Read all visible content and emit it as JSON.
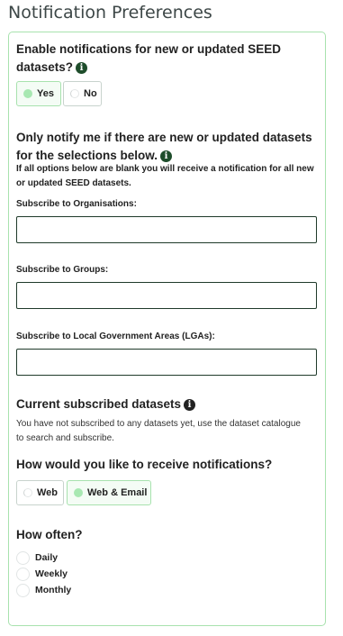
{
  "page_title": "Notification Preferences",
  "enable": {
    "question": "Enable notifications for new or updated SEED datasets?",
    "yes_label": "Yes",
    "no_label": "No",
    "selected": "Yes"
  },
  "filters": {
    "heading": "Only notify me if there are new or updated datasets for the selections below.",
    "note": "If all options below are blank you will receive a notification for all new or updated SEED datasets.",
    "organisations_label": "Subscribe to Organisations:",
    "organisations_value": "",
    "groups_label": "Subscribe to Groups:",
    "groups_value": "",
    "lgas_label": "Subscribe to Local Government Areas (LGAs):",
    "lgas_value": ""
  },
  "subscribed": {
    "heading": "Current subscribed datasets",
    "message": "You have not subscribed to any datasets yet, use the dataset catalogue to search and subscribe."
  },
  "method": {
    "question": "How would you like to receive notifications?",
    "web_label": "Web",
    "web_email_label": "Web & Email",
    "selected": "Web & Email"
  },
  "frequency": {
    "question": "How often?",
    "options": [
      "Daily",
      "Weekly",
      "Monthly"
    ]
  },
  "colors": {
    "accent_border": "#a8e2ae",
    "selected_dot": "#a8e8b2",
    "info_icon": "#1e4d2b"
  },
  "icons": [
    "info-icon",
    "radio-dot-icon"
  ]
}
